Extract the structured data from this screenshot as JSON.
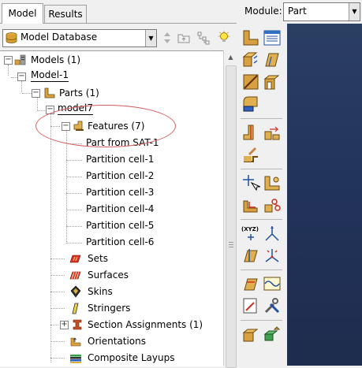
{
  "tabs": [
    {
      "label": "Model",
      "active": true
    },
    {
      "label": "Results",
      "active": false
    }
  ],
  "database_selector": {
    "value": "Model Database"
  },
  "module": {
    "label": "Module:",
    "value": "Part"
  },
  "tree": {
    "models": "Models (1)",
    "model1": "Model-1",
    "parts": "Parts (1)",
    "model7": "model7",
    "features": "Features (7)",
    "feature_items": [
      "Part from SAT-1",
      "Partition cell-1",
      "Partition cell-2",
      "Partition cell-3",
      "Partition cell-4",
      "Partition cell-5",
      "Partition cell-6"
    ],
    "sets": "Sets",
    "surfaces": "Surfaces",
    "skins": "Skins",
    "stringers": "Stringers",
    "section_assignments": "Section Assignments (1)",
    "orientations": "Orientations",
    "composite_layups": "Composite Layups"
  },
  "colors": {
    "viewport_bg": "#22335a",
    "annotation_ellipse": "#d85a5a",
    "part_icon": "#d8a040"
  }
}
